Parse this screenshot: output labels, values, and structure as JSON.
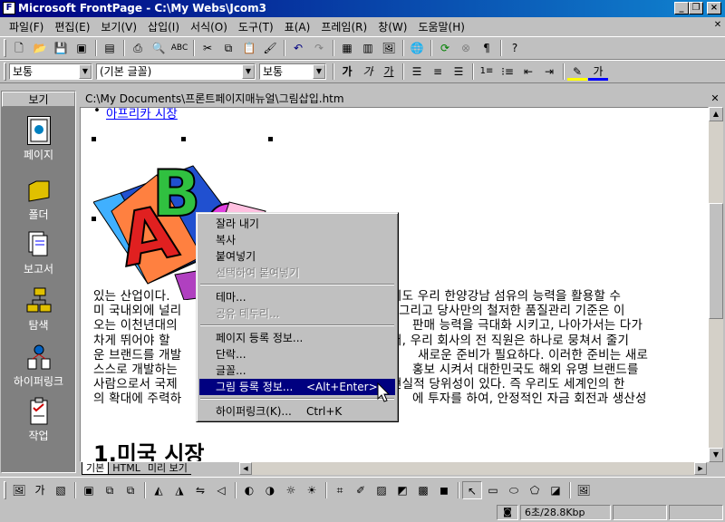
{
  "window": {
    "title": "Microsoft FrontPage - C:\\My Webs\\Jcom3"
  },
  "menubar": {
    "items": [
      "파일(F)",
      "편집(E)",
      "보기(V)",
      "삽입(I)",
      "서식(O)",
      "도구(T)",
      "표(A)",
      "프레임(R)",
      "창(W)",
      "도움말(H)"
    ]
  },
  "format_toolbar": {
    "style": "보통",
    "font": "(기본 글꼴)",
    "size": "보통"
  },
  "views": {
    "header": "보기",
    "items": [
      "페이지",
      "폴더",
      "보고서",
      "탐색",
      "하이퍼링크",
      "작업"
    ]
  },
  "document": {
    "path": "C:\\My Documents\\프론트페이지매뉴얼\\그림삽입.htm",
    "bullet_link": "아프리카 시장",
    "paragraph_lines": [
      "있는 산업이다. ",
      "미 국내외에 널리",
      "오는 이천년대의",
      "차게 뛰어야 할 ",
      "운 브랜드를 개발",
      "스스로 개발하는",
      "사람으로서 국제",
      "의 확대에 주력하"
    ],
    "right_lines": [
      "지도 우리 한양강남 섬유의 능력을 활용할 수",
      ". 그리고 당사만의 철저한 품질관리 기준은 이",
      "판매 능력을 극대화 시키고, 나아가서는 다가",
      "서, 우리 회사의 전 직원은 하나로 뭉쳐서 줄기",
      "새로운 준비가 필요하다. 이러한 준비는 새로",
      "홍보 시켜서 대한민국도 해외 유명 브랜드를",
      "현실적 당위성이 있다. 즉 우리도 세계인의 한",
      "에 투자를 하여, 안정적인 자금 회전과 생산성"
    ],
    "heading": "1.미국 시장",
    "tabs": [
      "기본",
      "HTML",
      "미리 보기"
    ]
  },
  "context_menu": {
    "items": [
      {
        "label": "잘라 내기",
        "shortcut": "",
        "disabled": false
      },
      {
        "label": "복사",
        "shortcut": "",
        "disabled": false
      },
      {
        "label": "붙여넣기",
        "shortcut": "",
        "disabled": false
      },
      {
        "label": "선택하여 붙여넣기",
        "shortcut": "",
        "disabled": true
      },
      {
        "label": "테마...",
        "shortcut": "",
        "disabled": false
      },
      {
        "label": "공유 테두리...",
        "shortcut": "",
        "disabled": true
      },
      {
        "label": "페이지 등록 정보...",
        "shortcut": "",
        "disabled": false
      },
      {
        "label": "단락...",
        "shortcut": "",
        "disabled": false
      },
      {
        "label": "글꼴...",
        "shortcut": "",
        "disabled": false
      },
      {
        "label": "그림 등록 정보...",
        "shortcut": "<Alt+Enter>",
        "disabled": false
      },
      {
        "label": "하이퍼링크(K)...",
        "shortcut": "Ctrl+K",
        "disabled": false
      }
    ]
  },
  "status": {
    "speed": "6초/28.8Kbp"
  },
  "colors": {
    "titlebar": "#000080",
    "link": "#0000ff",
    "menu_highlight": "#000080"
  }
}
